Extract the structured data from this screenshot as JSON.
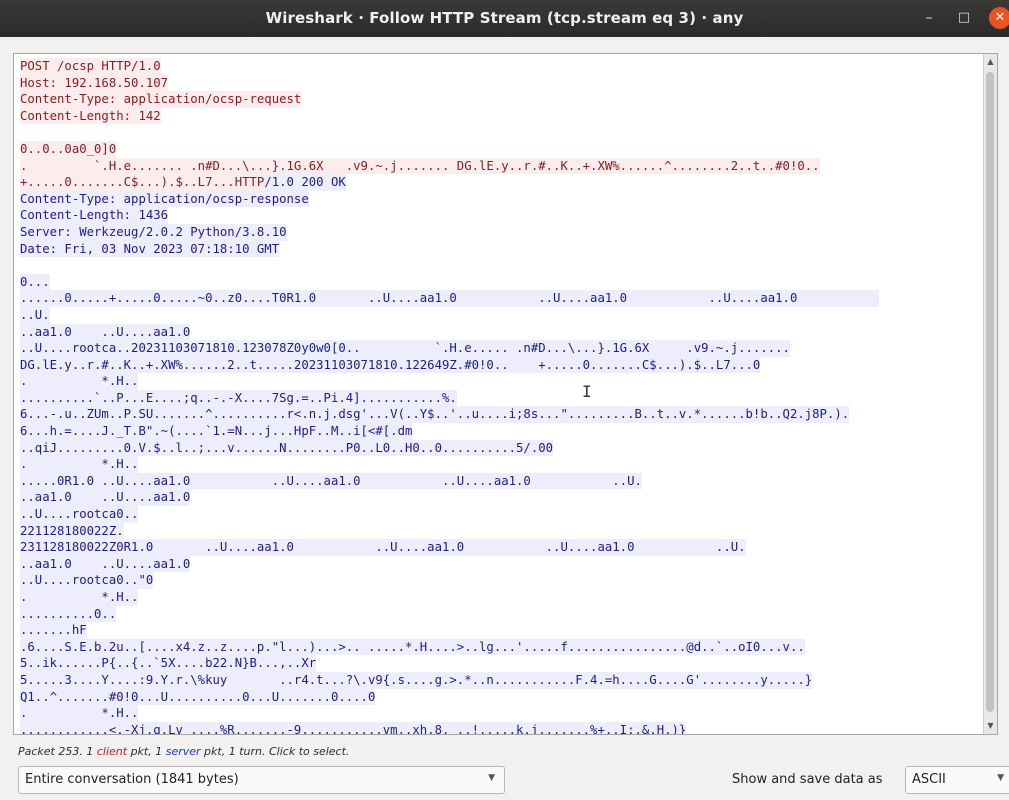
{
  "window": {
    "title": "Wireshark · Follow HTTP Stream (tcp.stream eq 3) · any",
    "minimize": "–",
    "maximize": "□",
    "close": "✕"
  },
  "stream": [
    {
      "dir": "client",
      "text": "POST /ocsp HTTP/1.0"
    },
    {
      "dir": "client",
      "text": "Host: 192.168.50.107"
    },
    {
      "dir": "client",
      "text": "Content-Type: application/ocsp-request"
    },
    {
      "dir": "client",
      "text": "Content-Length: 142"
    },
    {
      "dir": "none",
      "text": ""
    },
    {
      "dir": "client",
      "text": "0..0..0a0_0]0"
    },
    {
      "dir": "client",
      "text": ".         `.H.e....... .n#D...\\...}.1G.6X   .v9.~.j....... DG.lE.y..r.#..K..+.XW%......^........2..t..#0!0.."
    },
    {
      "dir": "client",
      "text": "+.....0.......C$...).$..L7...HTTP/1.0 200 OK",
      "split": 33
    },
    {
      "dir": "server",
      "text": "Content-Type: application/ocsp-response"
    },
    {
      "dir": "server",
      "text": "Content-Length: 1436"
    },
    {
      "dir": "server",
      "text": "Server: Werkzeug/2.0.2 Python/3.8.10"
    },
    {
      "dir": "server",
      "text": "Date: Fri, 03 Nov 2023 07:18:10 GMT"
    },
    {
      "dir": "none",
      "text": ""
    },
    {
      "dir": "server",
      "text": "0..."
    },
    {
      "dir": "server",
      "text": "......0.....+.....0.....~0..z0....T0R1.0       ..U....aa1.0           ..U....aa1.0           ..U....aa1.0           "
    },
    {
      "dir": "server",
      "text": "..U."
    },
    {
      "dir": "server",
      "text": "..aa1.0    ..U....aa1.0"
    },
    {
      "dir": "server",
      "text": "..U....rootca..20231103071810.123078Z0y0w0[0..          `.H.e..... .n#D...\\...}.1G.6X     .v9.~.j......."
    },
    {
      "dir": "server",
      "text": "DG.lE.y..r.#..K..+.XW%......2..t.....20231103071810.122649Z.#0!0..    +.....0.......C$...).$..L7...0"
    },
    {
      "dir": "server",
      "text": ".          *.H.."
    },
    {
      "dir": "server",
      "text": "..........`..P...E....;q..-.-X....7Sg.=..Pi.4]...........%."
    },
    {
      "dir": "server",
      "text": "6...-.u..ZUm..P.SU.......^..........r<.n.j.dsg'...V(..Y$..'..u....i;8s...\".........B..t..v.*......b!b..Q2.j8P.)."
    },
    {
      "dir": "server",
      "text": "6...h.=....J._T.B\".~(....`1.=N...j...HpF..M..i[<#[.dm"
    },
    {
      "dir": "server",
      "text": "..qiJ.........0.V.$..l..;...v......N........P0..L0..H0..0..........5/.00"
    },
    {
      "dir": "server",
      "text": ".          *.H.."
    },
    {
      "dir": "server",
      "text": ".....0R1.0 ..U....aa1.0           ..U....aa1.0           ..U....aa1.0           ..U."
    },
    {
      "dir": "server",
      "text": "..aa1.0    ..U....aa1.0"
    },
    {
      "dir": "server",
      "text": "..U....rootca0.."
    },
    {
      "dir": "server",
      "text": "221128180022Z."
    },
    {
      "dir": "server",
      "text": "231128180022Z0R1.0       ..U....aa1.0           ..U....aa1.0           ..U....aa1.0           ..U."
    },
    {
      "dir": "server",
      "text": "..aa1.0    ..U....aa1.0"
    },
    {
      "dir": "server",
      "text": "..U....rootca0..\"0"
    },
    {
      "dir": "server",
      "text": ".          *.H.."
    },
    {
      "dir": "server",
      "text": "..........0.."
    },
    {
      "dir": "server",
      "text": ".......hF"
    },
    {
      "dir": "server",
      "text": ".6....S.E.b.2u..[....x4.z..z....p.\"l...)...>.. .....*.H....>..lg...'.....f................@d..`..oI0...v.."
    },
    {
      "dir": "server",
      "text": "5..ik......P{..{..`5X....b22.N}B...,..Xr"
    },
    {
      "dir": "server",
      "text": "5.....3....Y....:9.Y.r.\\%kuy       ..r4.t...?\\.v9{.s....g.>.*..n...........F.4.=h....G....G'........y.....}"
    },
    {
      "dir": "server",
      "text": "Q1..^.......#0!0...U..........0...U.......0....0"
    },
    {
      "dir": "server",
      "text": ".          *.H.."
    },
    {
      "dir": "server",
      "text": "............<.-Xj.q.Lv ....%R.......-9...........vm..xh.8. ..!.....k.j.......%+..I:.&.H.)}"
    }
  ],
  "status": {
    "prefix": "Packet 253. 1 ",
    "client": "client",
    "mid1": " pkt, 1 ",
    "server": "server",
    "suffix": " pkt, 1 turn. Click to select."
  },
  "conversation_select": {
    "value": "Entire conversation (1841 bytes)"
  },
  "show_label": "Show and save data as",
  "format_select": {
    "value": "ASCII"
  }
}
